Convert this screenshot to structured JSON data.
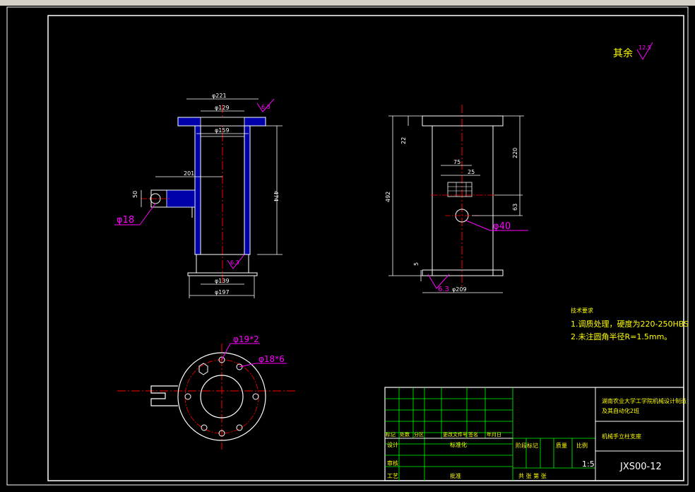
{
  "surface_finish_note": {
    "prefix": "其余",
    "value": "12.5"
  },
  "dims_front": {
    "d221": "φ221",
    "d129": "φ129",
    "d159": "φ159",
    "l201": "201",
    "d50": "50",
    "h474": "474",
    "d139": "φ139",
    "d197": "φ197",
    "hole18": "φ18",
    "rough_top": "6.3",
    "rough_bottom": "6.3"
  },
  "dims_side": {
    "h22": "22",
    "h220": "220",
    "w75": "75",
    "w25": "25",
    "h492": "492",
    "h63": "63",
    "h5": "5",
    "d209": "φ209",
    "hole40": "φ40",
    "rough": "6.3"
  },
  "dims_plan": {
    "holes_19": "φ19*2",
    "holes_18": "φ18*6"
  },
  "tech_req": {
    "title": "技术要求",
    "line1": "1.调质处理，硬度为220-250HBS",
    "line2": "2.未注圆角半径R=1.5mm。"
  },
  "title_block": {
    "school_line1": "湖南农业大学工学院机械设计制造",
    "school_line2": "及其自动化2班",
    "part_name": "机械手立柱支座",
    "scale": "1:5",
    "drawing_no": "JXS00-12",
    "row_header": [
      "标记",
      "处数",
      "分区",
      "更改文件号",
      "签名",
      "年月日"
    ],
    "design": "设计",
    "standardize": "标准化",
    "stage_header": [
      "阶段标记",
      "质量",
      "比例"
    ],
    "review": "审核",
    "process": "工艺",
    "approve": "批准",
    "sheets": "共 张 第 张"
  }
}
